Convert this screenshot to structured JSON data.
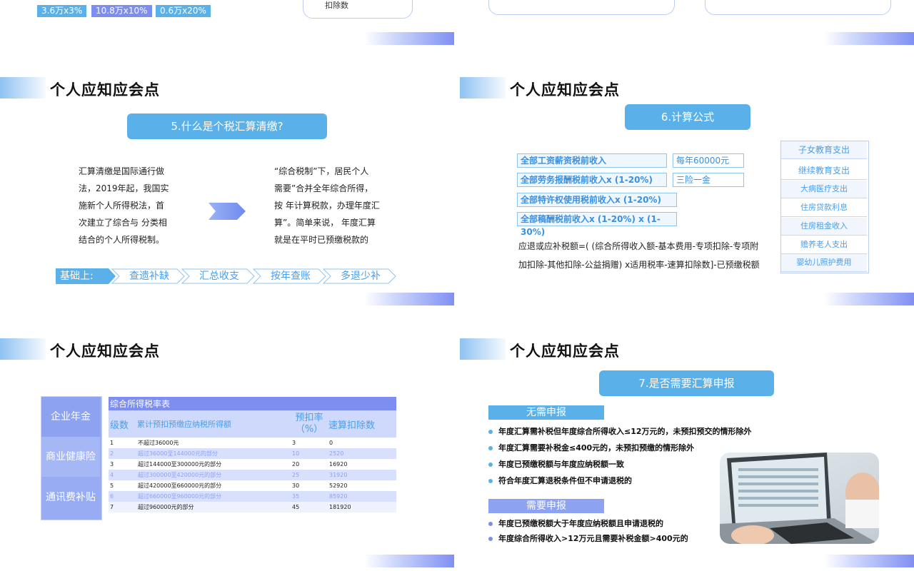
{
  "top_strip": {
    "tags": [
      {
        "label": "3.6万x3%",
        "color": "#5ab1ea"
      },
      {
        "label": "10.8万x10%",
        "color": "#7d8ef0"
      },
      {
        "label": "0.6万x20%",
        "color": "#5ab1ea"
      }
    ],
    "box_text": "扣除数"
  },
  "slide_header_title": "个人应知应会点",
  "slide2": {
    "pill": "5.什么是个税汇算清缴?",
    "left_lines": [
      "汇算清缴是国际通行做",
      "法，2019年起，我国实",
      "施新个人所得税法，首",
      "次建立了综合与 分类相",
      "结合的个人所得税制。"
    ],
    "right_lines": [
      "“综合税制”下，居民个人",
      "需要”合并全年综合所得，",
      "按 年计算税款，办理年度汇",
      "算”。简单来说， 年度汇算",
      "就是在平时已预缴税款的"
    ],
    "steps": [
      "基础上:",
      "查遗补缺",
      "汇总收支",
      "按年查账",
      "多退少补"
    ]
  },
  "slide3": {
    "pill": "6.计算公式",
    "rows": [
      "全部工资薪资税前收入",
      "全部劳务报酬税前收入x (1-20%)",
      "全部特许权使用税前收入x (1-20%)",
      "全部稿酬税前收入x (1-20%) x (1-30%)"
    ],
    "side": [
      "每年60000元",
      "三险一金"
    ],
    "formula_lines": [
      "应退或应补税额=( (综合所得收入额-基本费用-专项扣除-专项附",
      "加扣除-其他扣除-公益捐赠) x适用税率-速算扣除数]-已预缴税额"
    ],
    "deductions": [
      "子女教育支出",
      "继续教育支出",
      "大病医疗支出",
      "住房贷款利息",
      "住房租金收入",
      "赡养老人支出",
      "婴幼儿照护费用"
    ]
  },
  "slide4": {
    "side_items": [
      "企业年金",
      "商业健康险",
      "通讯费补贴"
    ],
    "table_title": "综合所得税率表",
    "headers": [
      "级数",
      "累计预扣预缴应纳税所得额",
      "预扣率（%）",
      "速算扣除数"
    ],
    "rows": [
      [
        "1",
        "不超过36000元",
        "3",
        "0"
      ],
      [
        "2",
        "超过36000至144000元的部分",
        "10",
        "2520"
      ],
      [
        "3",
        "超过144000至300000元的部分",
        "20",
        "16920"
      ],
      [
        "4",
        "超过300000至420000元的部分",
        "25",
        "31920"
      ],
      [
        "5",
        "超过420000至660000元的部分",
        "30",
        "52920"
      ],
      [
        "6",
        "超过660000至960000元的部分",
        "35",
        "85920"
      ],
      [
        "7",
        "超过960000元的部分",
        "45",
        "181920"
      ]
    ]
  },
  "slide5": {
    "pill": "7.是否需要汇算申报",
    "no_need_label": "无需申报",
    "no_need_items": [
      "年度汇算需补税但年度综合所得收入≤12万元的，未预扣预交的情形除外",
      "年度汇算需要补税金≤400元的，未预扣预缴的情形除外",
      "年度已预缴税额与年度应纳税额一致",
      "符合年度汇算退税条件但不申请退税的"
    ],
    "need_label": "需要申报",
    "need_items": [
      "年度已预缴税额大于年度应纳税额且申请退税的",
      "年度综合所得收入>12万元且需要补税金额>400元的"
    ],
    "colors": {
      "accent": "#5ab1ea",
      "purple": "#7d8ef0"
    }
  }
}
